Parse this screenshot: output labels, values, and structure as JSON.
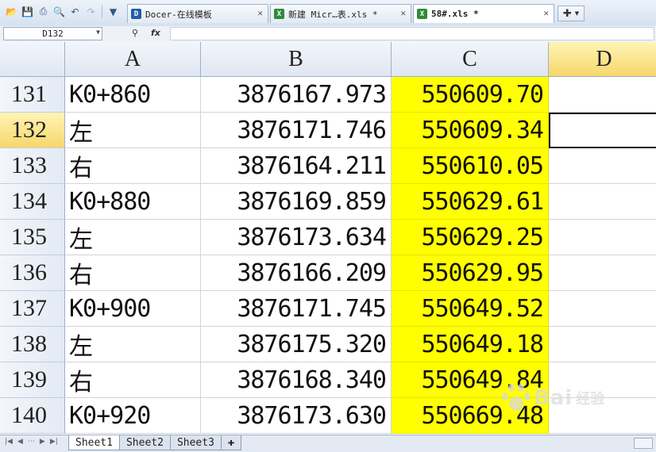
{
  "toolbar": {
    "icons": [
      "open-folder-icon",
      "save-icon",
      "print-icon",
      "print-preview-icon",
      "undo-icon",
      "redo-icon",
      "customize-dropdown-icon"
    ]
  },
  "tabs": [
    {
      "label": "Docer-在线模板",
      "icon": "docer-icon",
      "active": false
    },
    {
      "label": "新建 Micr…表.xls *",
      "icon": "xls-icon",
      "active": false
    },
    {
      "label": "58#.xls *",
      "icon": "xls-icon",
      "active": true
    }
  ],
  "formula_bar": {
    "name_box": "D132",
    "formula": ""
  },
  "columns": [
    "A",
    "B",
    "C",
    "D"
  ],
  "active_column": "D",
  "active_row": "132",
  "rows": [
    {
      "n": "131",
      "a": "K0+860",
      "b": "3876167.973",
      "c": "550609.70",
      "d": ""
    },
    {
      "n": "132",
      "a": "左",
      "b": "3876171.746",
      "c": "550609.34",
      "d": ""
    },
    {
      "n": "133",
      "a": "右",
      "b": "3876164.211",
      "c": "550610.05",
      "d": ""
    },
    {
      "n": "134",
      "a": "K0+880",
      "b": "3876169.859",
      "c": "550629.61",
      "d": ""
    },
    {
      "n": "135",
      "a": "左",
      "b": "3876173.634",
      "c": "550629.25",
      "d": ""
    },
    {
      "n": "136",
      "a": "右",
      "b": "3876166.209",
      "c": "550629.95",
      "d": ""
    },
    {
      "n": "137",
      "a": "K0+900",
      "b": "3876171.745",
      "c": "550649.52",
      "d": ""
    },
    {
      "n": "138",
      "a": "左",
      "b": "3876175.320",
      "c": "550649.18",
      "d": ""
    },
    {
      "n": "139",
      "a": "右",
      "b": "3876168.340",
      "c": "550649.84",
      "d": ""
    },
    {
      "n": "140",
      "a": "K0+920",
      "b": "3876173.630",
      "c": "550669.48",
      "d": ""
    }
  ],
  "sheets": [
    "Sheet1",
    "Sheet2",
    "Sheet3"
  ],
  "active_sheet": "Sheet1",
  "colors": {
    "highlight_fill": "#ffff00",
    "header_active": "#f7d76b"
  },
  "watermark": {
    "text": "Bai",
    "text2": "经验"
  }
}
